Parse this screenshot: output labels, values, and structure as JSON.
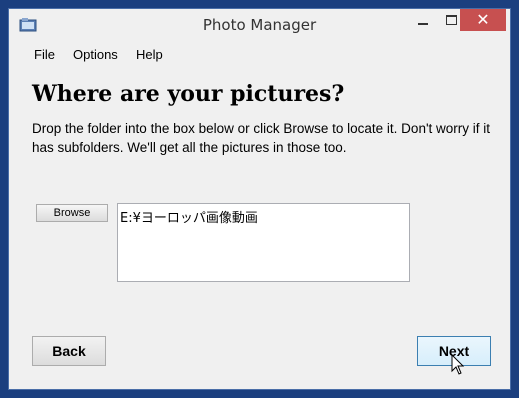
{
  "window": {
    "title": "Photo Manager",
    "icon": "app-icon"
  },
  "menu": {
    "items": [
      {
        "label": "File"
      },
      {
        "label": "Options"
      },
      {
        "label": "Help"
      }
    ]
  },
  "main": {
    "heading": "Where are your pictures?",
    "description": "Drop the folder into the box below or click Browse to locate it.  Don't worry if it has subfolders.  We'll get all the pictures in those too.",
    "browse_label": "Browse",
    "folder_path": "E:¥ヨーロッパ画像動画"
  },
  "footer": {
    "back_label": "Back",
    "next_label": "Next"
  },
  "colors": {
    "desktop": "#1b3f7f",
    "close_button": "#c75050",
    "next_border": "#3c7fb1"
  }
}
